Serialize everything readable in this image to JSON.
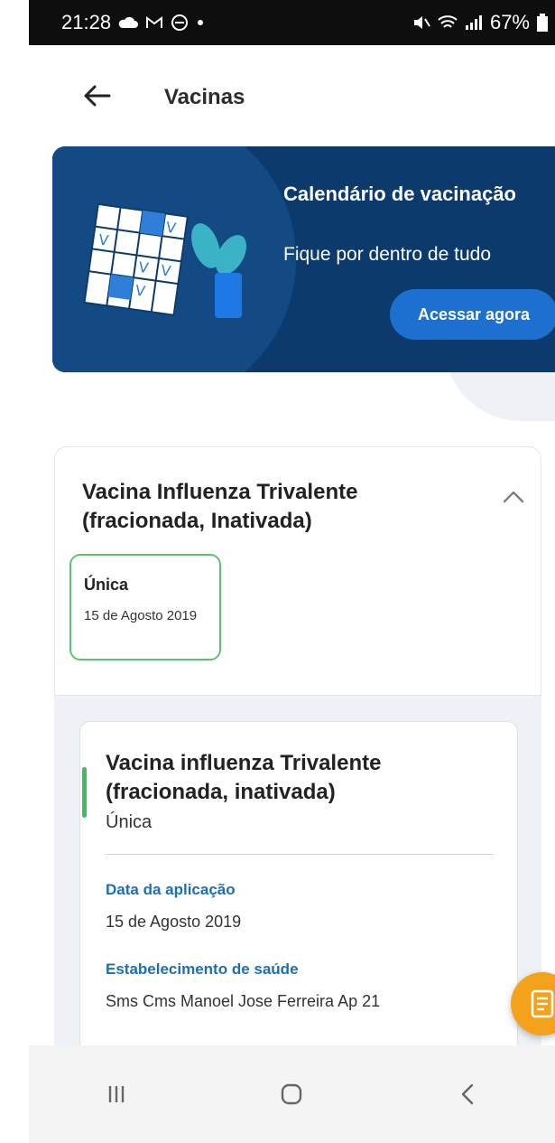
{
  "status_bar": {
    "time": "21:28",
    "battery": "67%",
    "icons": [
      "cloud-icon",
      "gmail-icon",
      "do-not-disturb-icon",
      "dot-icon",
      "mute-icon",
      "wifi-icon",
      "signal-icon",
      "battery-icon"
    ]
  },
  "header": {
    "title": "Vacinas",
    "back_icon": "arrow-left-icon"
  },
  "banner": {
    "title": "Calendário de vacinação",
    "subtitle": "Fique por dentro de tudo",
    "cta_label": "Acessar agora",
    "colors": {
      "background": "#0c3a6d",
      "button": "#1d6fd0"
    }
  },
  "vaccine": {
    "name": "Vacina Influenza Trivalente (fracionada, Inativada)",
    "dose": {
      "label": "Única",
      "date": "15 de Agosto 2019"
    }
  },
  "detail": {
    "title": "Vacina influenza Trivalente (fracionada, inativada)",
    "dose": "Única",
    "application_date_label": "Data da aplicação",
    "application_date": "15 de Agosto 2019",
    "facility_label": "Estabelecimento de saúde",
    "facility": "Sms Cms Manoel Jose Ferreira Ap 21"
  },
  "fab": {
    "icon": "document-icon",
    "color": "#f4a21c"
  },
  "nav": {
    "recents_icon": "recents-icon",
    "home_icon": "home-icon",
    "back_icon": "back-chevron-icon"
  }
}
